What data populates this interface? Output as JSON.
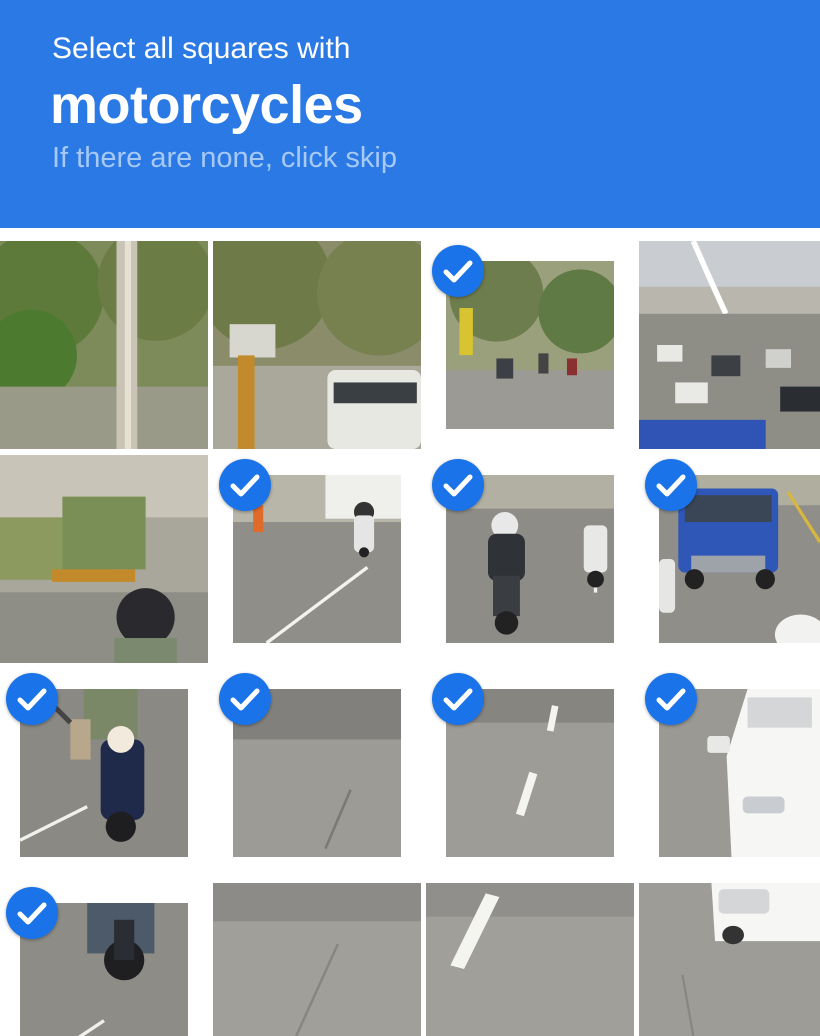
{
  "header": {
    "line1": "Select all squares with",
    "target": "motorcycles",
    "line3": "If there are none, click skip",
    "bg_color": "#2a79e4"
  },
  "grid": {
    "rows": 4,
    "cols": 4,
    "accent_color": "#1a73e8",
    "tiles": [
      {
        "row": 0,
        "col": 0,
        "scene": "trees-pole",
        "selected": false
      },
      {
        "row": 0,
        "col": 1,
        "scene": "trees-van",
        "selected": false
      },
      {
        "row": 0,
        "col": 2,
        "scene": "street-far",
        "selected": true
      },
      {
        "row": 0,
        "col": 3,
        "scene": "traffic-bridge",
        "selected": false
      },
      {
        "row": 1,
        "col": 0,
        "scene": "wall-rider-head",
        "selected": false
      },
      {
        "row": 1,
        "col": 1,
        "scene": "road-scooter-far",
        "selected": true
      },
      {
        "row": 1,
        "col": 2,
        "scene": "road-rider",
        "selected": true
      },
      {
        "row": 1,
        "col": 3,
        "scene": "road-truck",
        "selected": true
      },
      {
        "row": 2,
        "col": 0,
        "scene": "scooter-rider",
        "selected": true
      },
      {
        "row": 2,
        "col": 1,
        "scene": "road-shadow",
        "selected": true
      },
      {
        "row": 2,
        "col": 2,
        "scene": "road-lane",
        "selected": true
      },
      {
        "row": 2,
        "col": 3,
        "scene": "road-car",
        "selected": true
      },
      {
        "row": 3,
        "col": 0,
        "scene": "scooter-wheel",
        "selected": true
      },
      {
        "row": 3,
        "col": 1,
        "scene": "road-plain",
        "selected": false
      },
      {
        "row": 3,
        "col": 2,
        "scene": "road-lane-2",
        "selected": false
      },
      {
        "row": 3,
        "col": 3,
        "scene": "road-car-rear",
        "selected": false
      }
    ]
  }
}
